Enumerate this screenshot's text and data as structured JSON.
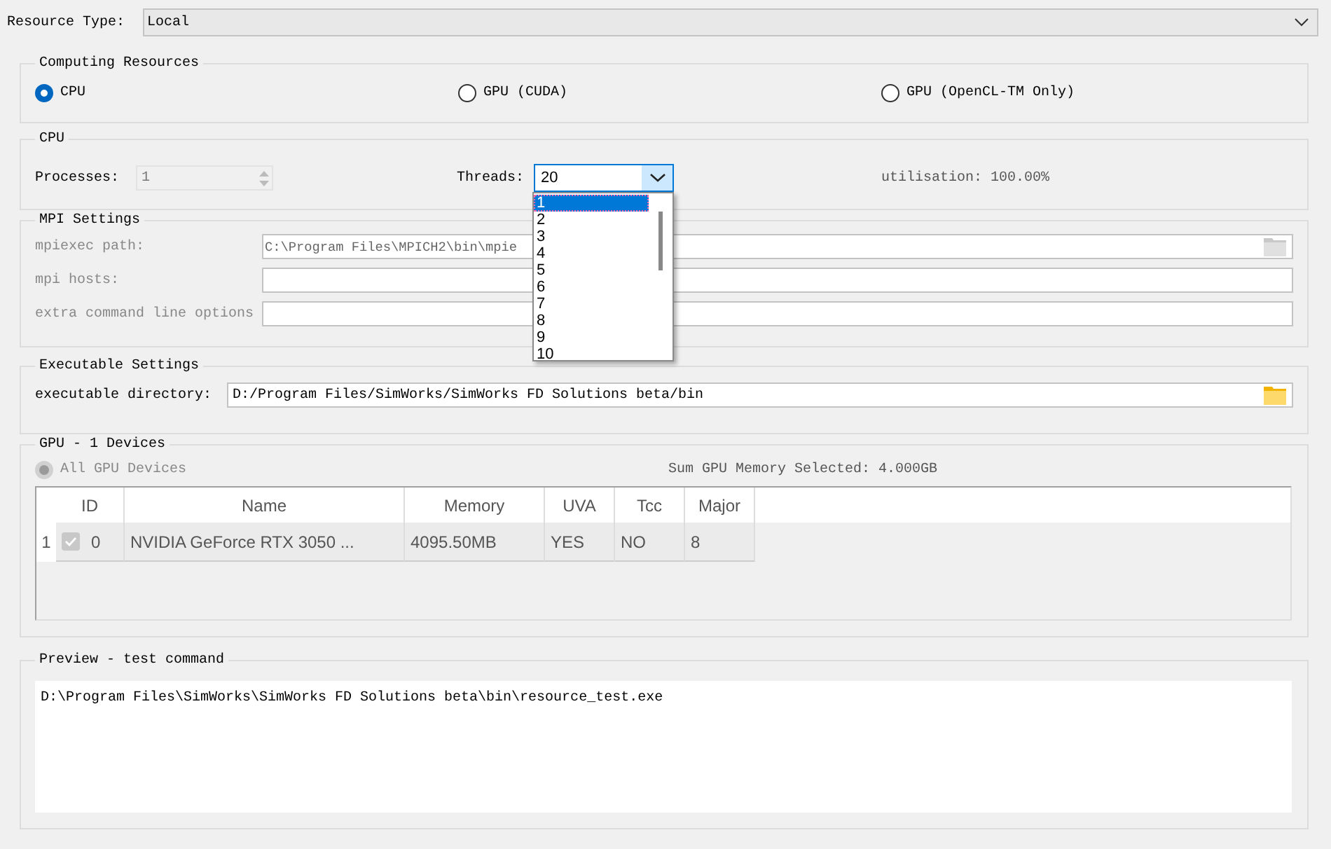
{
  "resource_type": {
    "label": "Resource Type:",
    "value": "Local"
  },
  "computing_resources": {
    "title": "Computing Resources",
    "options": [
      {
        "label": "CPU",
        "selected": true
      },
      {
        "label": "GPU (CUDA)",
        "selected": false
      },
      {
        "label": "GPU (OpenCL-TM Only)",
        "selected": false
      }
    ]
  },
  "cpu": {
    "title": "CPU",
    "processes": {
      "label": "Processes:",
      "value": "1",
      "disabled": true
    },
    "threads": {
      "label": "Threads:",
      "value": "20",
      "expanded": true,
      "options": [
        {
          "label": "1",
          "selected": true
        },
        {
          "label": "2",
          "selected": false
        },
        {
          "label": "3",
          "selected": false
        },
        {
          "label": "4",
          "selected": false
        },
        {
          "label": "5",
          "selected": false
        },
        {
          "label": "6",
          "selected": false
        },
        {
          "label": "7",
          "selected": false
        },
        {
          "label": "8",
          "selected": false
        },
        {
          "label": "9",
          "selected": false
        },
        {
          "label": "10",
          "selected": false
        }
      ]
    },
    "utilisation": "utilisation: 100.00%"
  },
  "mpi": {
    "title": "MPI Settings",
    "disabled": true,
    "fields": [
      {
        "label": "mpiexec path:",
        "value": "C:\\Program Files\\MPICH2\\bin\\mpie",
        "browse": true
      },
      {
        "label": "mpi hosts:",
        "browse": false
      },
      {
        "label": "extra command line options",
        "browse": false
      }
    ]
  },
  "executable": {
    "title": "Executable Settings",
    "label": "executable directory:",
    "value": "D:/Program Files/SimWorks/SimWorks FD Solutions beta/bin"
  },
  "gpu": {
    "title": "GPU - 1 Devices",
    "all_devices": {
      "label": "All GPU Devices",
      "selected": true,
      "disabled": true
    },
    "memory_summary": "Sum GPU Memory Selected: 4.000GB",
    "table": {
      "columns": [
        "ID",
        "Name",
        "Memory",
        "UVA",
        "Tcc",
        "Major"
      ],
      "rows": [
        {
          "row_number": "1",
          "checked": true,
          "cells": [
            "0",
            "NVIDIA GeForce RTX 3050 ...",
            "4095.50MB",
            "YES",
            "NO",
            "8"
          ]
        }
      ]
    }
  },
  "preview": {
    "title": "Preview - test command",
    "text": "D:\\Program Files\\SimWorks\\SimWorks FD Solutions beta\\bin\\resource_test.exe"
  }
}
